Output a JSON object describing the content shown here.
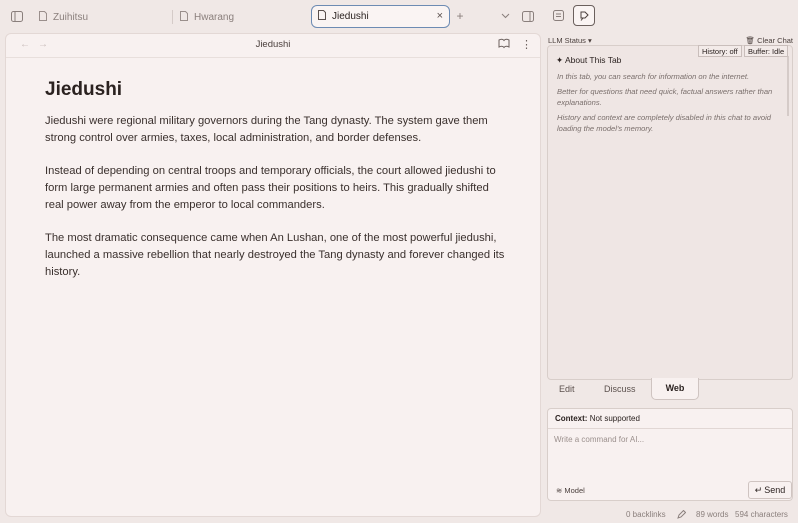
{
  "tabs": [
    {
      "label": "Zuihitsu"
    },
    {
      "label": "Hwarang"
    },
    {
      "label": "Jiedushi",
      "active": true
    }
  ],
  "tab_controls": {
    "close": "×",
    "new_tab": "+",
    "dropdown": "⌄"
  },
  "editor": {
    "title": "Jiedushi",
    "back": "←",
    "forward": "→",
    "more": "⋮"
  },
  "document": {
    "heading": "Jiedushi",
    "paragraphs": [
      "Jiedushi were regional military governors during the Tang dynasty. The system gave them strong control over armies, taxes, local administration, and border defenses.",
      "Instead of depending on central troops and temporary officials, the court allowed jiedushi to form large permanent armies and often pass their positions to heirs. This gradually shifted real power away from the emperor to local commanders.",
      "The most dramatic consequence came when An Lushan, one of the most powerful jiedushi, launched a massive rebellion that nearly destroyed the Tang dynasty and forever changed its history."
    ]
  },
  "ai_panel": {
    "llm_status": "LLM Status ▾",
    "clear_chat": "Clear Chat",
    "history_badge": "History: off",
    "buffer_badge": "Buffer: Idle",
    "about_title": "✦ About This Tab",
    "about_lines": [
      "In this tab, you can search for information on the internet.",
      "Better for questions that need quick, factual answers rather than explanations.",
      "History and context are completely disabled in this chat to avoid loading the model's memory."
    ],
    "modes": [
      "Edit",
      "Discuss",
      "Web"
    ],
    "active_mode": "Web",
    "context_label": "Context:",
    "context_value": "Not supported",
    "input_placeholder": "Write a command for AI...",
    "model_label": "Model",
    "send_label": "Send"
  },
  "status_bar": {
    "backlinks": "0 backlinks",
    "words": "89 words",
    "characters": "594 characters"
  },
  "colors": {
    "background": "#f0e8e6",
    "editor_bg": "#f8f1f0",
    "active_tab_border": "#6d8bb3"
  }
}
